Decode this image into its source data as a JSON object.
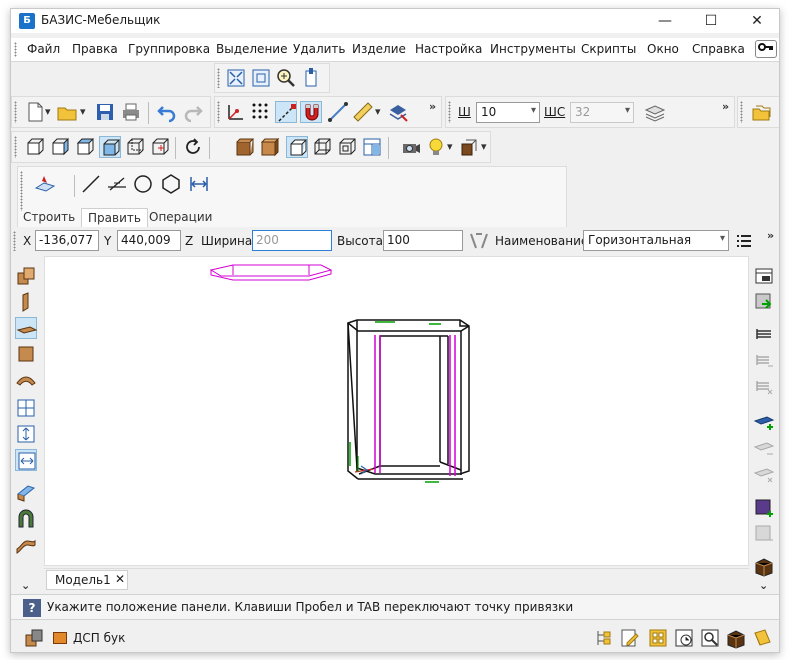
{
  "window": {
    "title": "БАЗИС-Мебельщик",
    "app_icon_text": "Б",
    "minimize": "—",
    "maximize": "☐",
    "close": "✕"
  },
  "menu": {
    "items": [
      "Файл",
      "Правка",
      "Группировка",
      "Выделение",
      "Удалить",
      "Изделие",
      "Настройка",
      "Инструменты",
      "Скрипты",
      "Окно",
      "Справка"
    ],
    "key_icon": "key-icon"
  },
  "toolbar": {
    "w_label": "Ш",
    "w_value": "10",
    "ws_label": "ШС",
    "ws_value": "32",
    "more": "»"
  },
  "tabs": {
    "items": [
      "Строить",
      "Править",
      "Операции"
    ],
    "selected": "Править"
  },
  "coords": {
    "x_label": "X",
    "x_value": "-136,077",
    "y_label": "Y",
    "y_value": "440,009",
    "z_label": "Z",
    "width_label": "Ширина",
    "width_value": "200",
    "height_label": "Высота",
    "height_value": "100",
    "name_label": "Наименование",
    "name_value": "Горизонтальная"
  },
  "model_tab": {
    "label": "Модель1",
    "close": "✕"
  },
  "status": {
    "help": "?",
    "text": "Укажите положение панели. Клавиши Пробел и TAB переключают точку привязки"
  },
  "bottom": {
    "material": "ДСП бук"
  },
  "chevrons": {
    "down": "⌄"
  },
  "colors": {
    "accent": "#1a73c9",
    "active_bg": "#cde6f7",
    "magenta": "#d400d4",
    "green": "#00a000",
    "wood": "#a0652e"
  }
}
